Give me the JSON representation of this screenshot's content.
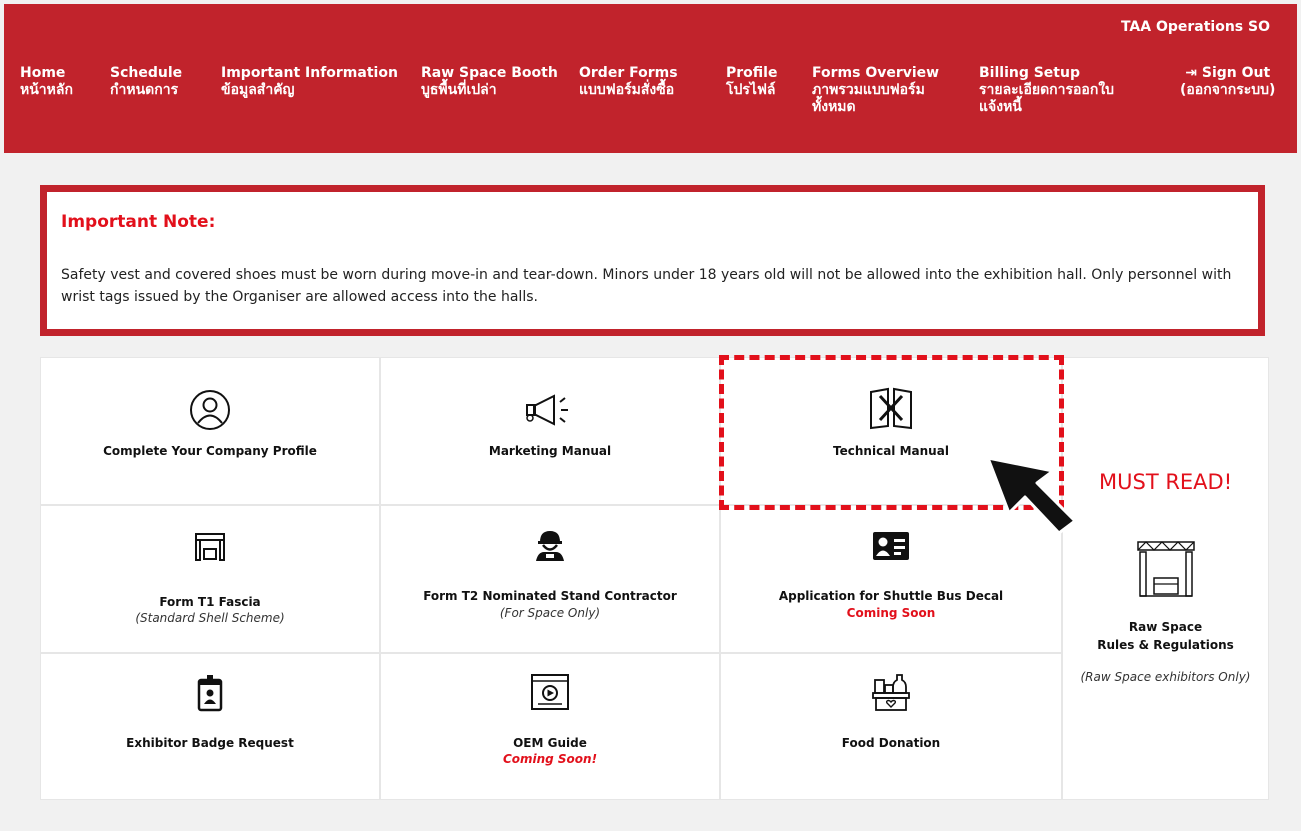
{
  "header": {
    "user_name": "TAA Operations SO",
    "nav": [
      {
        "en": "Home",
        "th": "หน้าหลัก"
      },
      {
        "en": "Schedule",
        "th": "กำหนดการ"
      },
      {
        "en": "Important Information",
        "th": "ข้อมูลสำคัญ"
      },
      {
        "en": "Raw Space Booth",
        "th": "บูธพื้นที่เปล่า"
      },
      {
        "en": "Order Forms",
        "th": "แบบฟอร์มสั่งซื้อ"
      },
      {
        "en": "Profile",
        "th": "โปรไฟล์"
      },
      {
        "en": "Forms Overview",
        "th": "ภาพรวมแบบฟอร์มทั้งหมด"
      },
      {
        "en": "Billing Setup",
        "th": "รายละเอียดการออกใบแจ้งหนี้"
      }
    ],
    "signout": {
      "en": "⇥ Sign Out",
      "th": "(ออกจากระบบ)"
    }
  },
  "note": {
    "title": "Important Note:",
    "text": "Safety vest and covered shoes must be worn during move-in and tear-down. Minors under 18 years old will not be allowed into the exhibition hall. Only personnel with wrist tags issued by the Organiser are allowed access into the halls."
  },
  "cards": {
    "profile": {
      "title": "Complete Your Company Profile",
      "icon": "user-circle-icon"
    },
    "marketing": {
      "title": "Marketing Manual",
      "icon": "megaphone-icon"
    },
    "technical": {
      "title": "Technical Manual",
      "icon": "tools-manual-icon"
    },
    "t1": {
      "title": "Form T1 Fascia",
      "sub": "(Standard Shell Scheme)",
      "icon": "booth-icon"
    },
    "t2": {
      "title": "Form T2 Nominated Stand Contractor",
      "sub": "(For Space Only)",
      "icon": "worker-icon"
    },
    "shuttle": {
      "title": "Application for Shuttle Bus Decal",
      "soon": "Coming Soon",
      "icon": "id-card-icon"
    },
    "badge": {
      "title": "Exhibitor Badge Request",
      "icon": "badge-icon"
    },
    "oem": {
      "title": "OEM Guide",
      "soon": "Coming Soon!",
      "icon": "video-icon"
    },
    "food": {
      "title": "Food Donation",
      "icon": "food-box-icon"
    },
    "rawspace": {
      "title1": "Raw Space",
      "title2": "Rules & Regulations",
      "sub": "(Raw Space exhibitors Only)",
      "icon": "stage-truss-icon"
    }
  },
  "callout": {
    "must_read": "MUST READ!"
  },
  "colors": {
    "brand": "#c1232c",
    "accent": "#e2101b"
  }
}
